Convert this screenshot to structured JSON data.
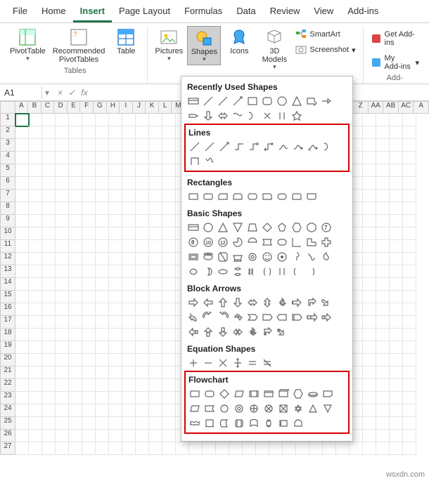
{
  "tabs": [
    "File",
    "Home",
    "Insert",
    "Page Layout",
    "Formulas",
    "Data",
    "Review",
    "View",
    "Add-ins"
  ],
  "active_tab": "Insert",
  "ribbon": {
    "tables": {
      "pivottable": "PivotTable",
      "recommended": "Recommended\nPivotTables",
      "table": "Table",
      "group_label": "Tables"
    },
    "illustrations": {
      "pictures": "Pictures",
      "shapes": "Shapes",
      "icons": "Icons",
      "models": "3D\nModels",
      "smartart": "SmartArt",
      "screenshot": "Screenshot"
    },
    "addins": {
      "get": "Get Add-ins",
      "my": "My Add-ins",
      "group_label": "Add-"
    }
  },
  "namebox": "A1",
  "columns": [
    "A",
    "B",
    "C",
    "D",
    "E",
    "F",
    "G",
    "H",
    "I",
    "J",
    "K",
    "L",
    "M",
    "Z",
    "AA",
    "AB",
    "AC",
    "A"
  ],
  "row_count": 27,
  "shapes_menu": {
    "recent": "Recently Used Shapes",
    "lines": "Lines",
    "rectangles": "Rectangles",
    "basic": "Basic Shapes",
    "arrows": "Block Arrows",
    "equation": "Equation Shapes",
    "flowchart": "Flowchart"
  },
  "watermark": "wsxdn.com"
}
